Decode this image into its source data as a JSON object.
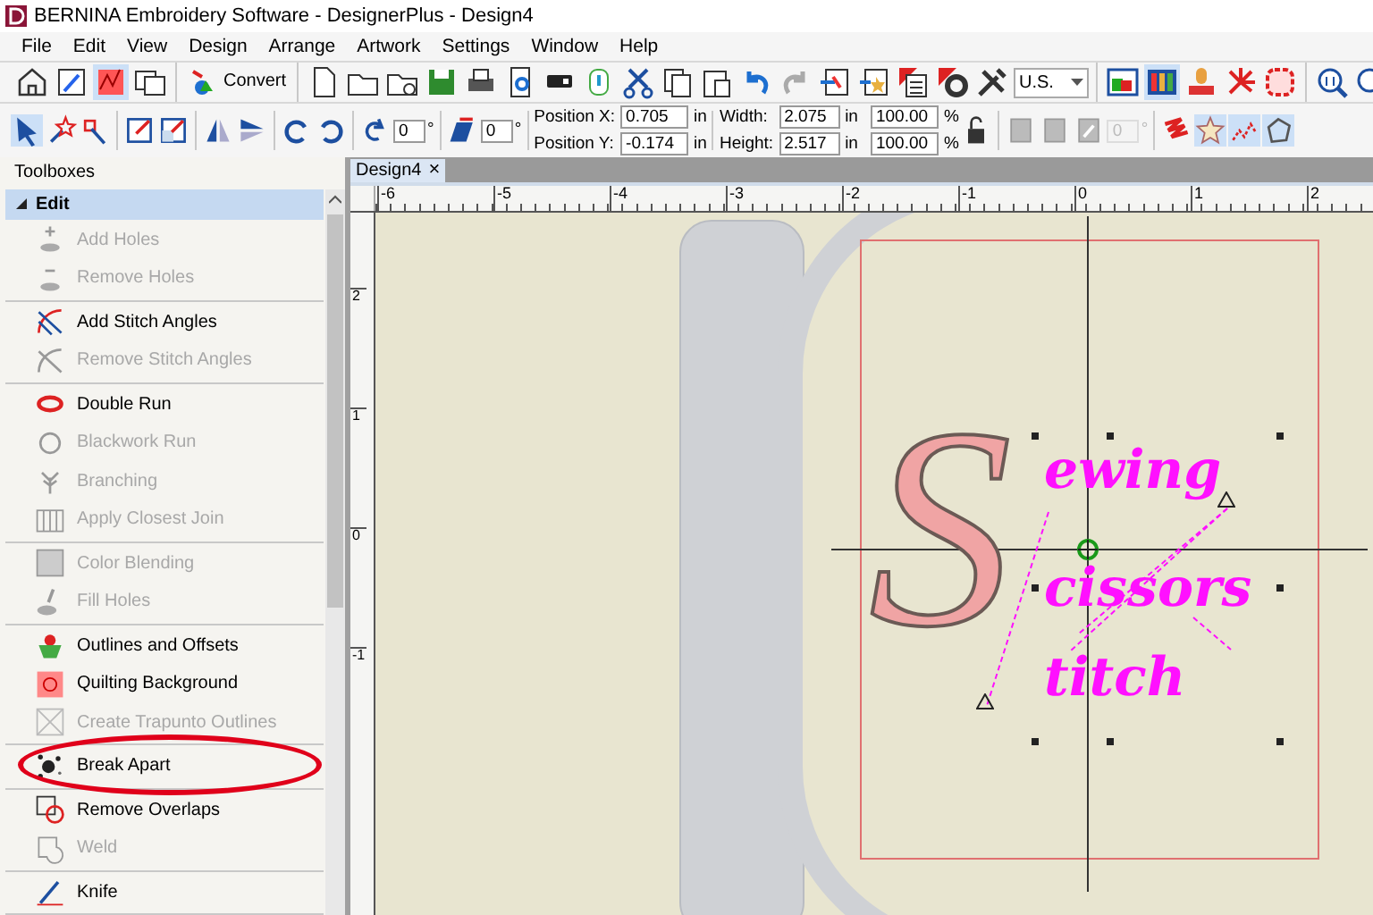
{
  "window": {
    "title": "BERNINA Embroidery Software - DesignerPlus - Design4"
  },
  "menu": [
    "File",
    "Edit",
    "View",
    "Design",
    "Arrange",
    "Artwork",
    "Settings",
    "Window",
    "Help"
  ],
  "toolbar_top": {
    "buttons_left": [
      {
        "selected": false
      },
      {
        "selected": false
      },
      {
        "selected": true
      },
      {
        "selected": false
      }
    ],
    "convert_button": "Convert",
    "units": "U.S.",
    "buttons_right": [
      {
        "selected": false
      },
      {
        "selected": true
      },
      {
        "selected": false
      },
      {
        "selected": false
      },
      {
        "selected": false
      }
    ]
  },
  "toolbar_transform": {
    "select_buttons": [
      {
        "selected": true
      },
      {
        "selected": false
      },
      {
        "selected": false
      }
    ],
    "rotate": {
      "value": "0",
      "unit": "°"
    },
    "skew": {
      "value": "0",
      "unit": "°"
    },
    "position": [
      {
        "label": "Position X:",
        "value": "0.705",
        "unit": "in"
      },
      {
        "label": "Position Y:",
        "value": "-0.174",
        "unit": "in"
      }
    ],
    "size": [
      {
        "label": "Width:",
        "value": "2.075",
        "unit": "in",
        "scale": "100.00",
        "scale_unit": "%"
      },
      {
        "label": "Height:",
        "value": "2.517",
        "unit": "in",
        "scale": "100.00",
        "scale_unit": "%"
      }
    ],
    "angle_field": {
      "value": "0",
      "unit": "°",
      "disabled": true
    },
    "stitch_buttons": [
      {
        "selected": false
      },
      {
        "selected": true
      },
      {
        "selected": true
      },
      {
        "selected": true
      }
    ]
  },
  "toolboxes": {
    "title": "Toolboxes",
    "section": {
      "label": "Edit",
      "expanded": true,
      "groups": [
        [
          {
            "label": "Add Holes",
            "disabled": true
          },
          {
            "label": "Remove Holes",
            "disabled": true
          }
        ],
        [
          {
            "label": "Add Stitch Angles",
            "disabled": false
          },
          {
            "label": "Remove Stitch Angles",
            "disabled": true
          }
        ],
        [
          {
            "label": "Double Run",
            "disabled": false
          },
          {
            "label": "Blackwork Run",
            "disabled": true
          },
          {
            "label": "Branching",
            "disabled": true
          },
          {
            "label": "Apply Closest Join",
            "disabled": true
          }
        ],
        [
          {
            "label": "Color Blending",
            "disabled": true
          },
          {
            "label": "Fill Holes",
            "disabled": true
          }
        ],
        [
          {
            "label": "Outlines and Offsets",
            "disabled": false
          },
          {
            "label": "Quilting Background",
            "disabled": false
          },
          {
            "label": "Create Trapunto Outlines",
            "disabled": true
          }
        ],
        [
          {
            "label": "Break Apart",
            "disabled": false,
            "circled": true
          }
        ],
        [
          {
            "label": "Remove Overlaps",
            "disabled": false
          },
          {
            "label": "Weld",
            "disabled": true
          }
        ],
        [
          {
            "label": "Knife",
            "disabled": false
          }
        ]
      ]
    }
  },
  "document_tab": {
    "label": "Design4",
    "close": "×"
  },
  "ruler_horizontal": [
    "-6",
    "-5",
    "-4",
    "-3",
    "-2",
    "-1",
    "0",
    "1",
    "2"
  ],
  "ruler_vertical": [
    "2",
    "1",
    "0",
    "-1"
  ],
  "design": {
    "initial": "S",
    "lines": [
      "ewing",
      "cissors",
      "titch"
    ]
  }
}
